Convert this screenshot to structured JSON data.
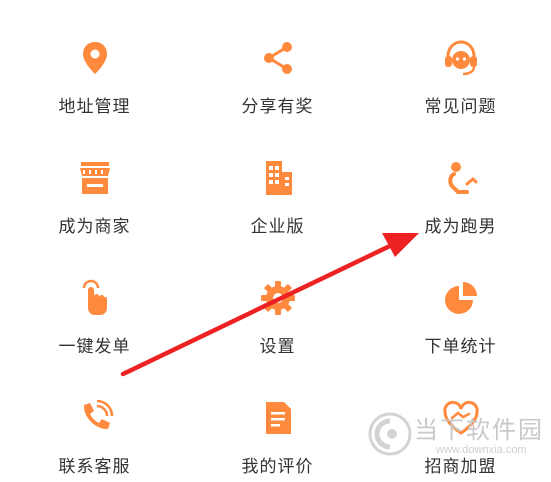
{
  "accent": "#ff8a3d",
  "items": [
    {
      "label": "地址管理",
      "icon": "location-pin"
    },
    {
      "label": "分享有奖",
      "icon": "share"
    },
    {
      "label": "常见问题",
      "icon": "customer-service"
    },
    {
      "label": "成为商家",
      "icon": "store"
    },
    {
      "label": "企业版",
      "icon": "building"
    },
    {
      "label": "成为跑男",
      "icon": "runner"
    },
    {
      "label": "一键发单",
      "icon": "tap"
    },
    {
      "label": "设置",
      "icon": "gear"
    },
    {
      "label": "下单统计",
      "icon": "pie-chart"
    },
    {
      "label": "联系客服",
      "icon": "phone"
    },
    {
      "label": "我的评价",
      "icon": "document"
    },
    {
      "label": "招商加盟",
      "icon": "heart-handshake"
    }
  ],
  "annotation": {
    "color": "#ee2222"
  },
  "watermark": {
    "text": "当下软件园",
    "url": "www.downxia.com"
  }
}
